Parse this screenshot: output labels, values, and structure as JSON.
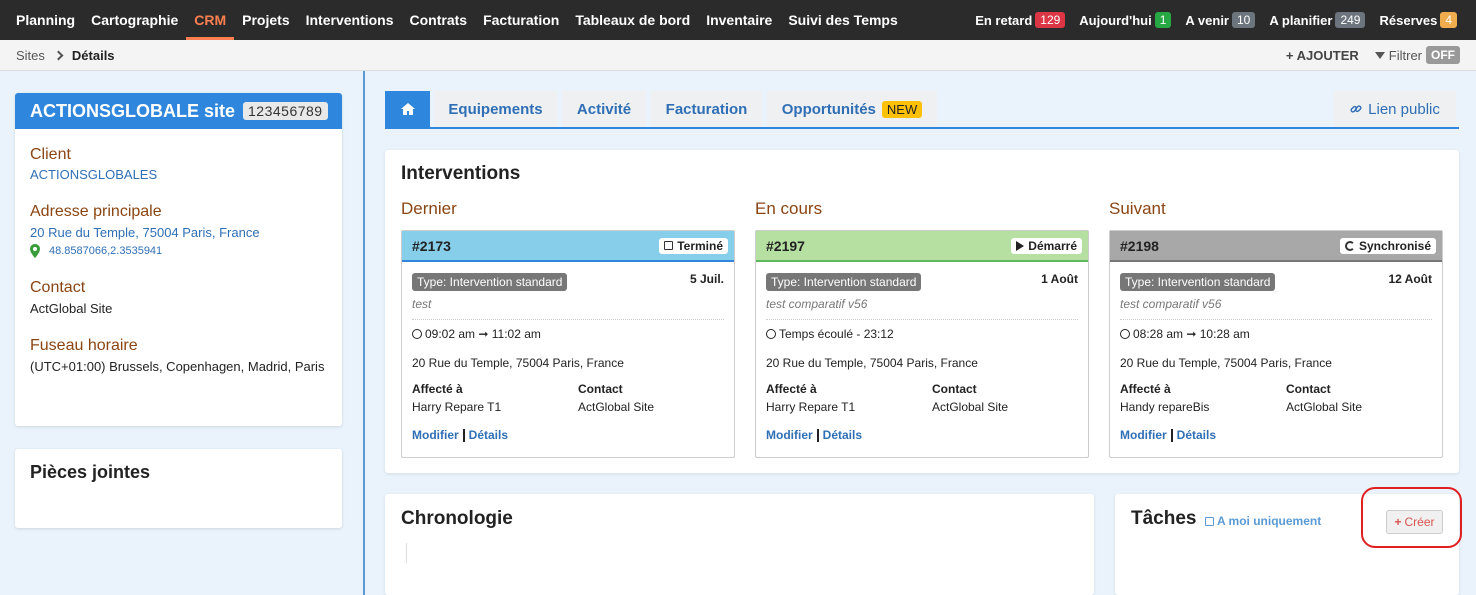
{
  "nav": {
    "items": [
      "Planning",
      "Cartographie",
      "CRM",
      "Projets",
      "Interventions",
      "Contrats",
      "Facturation",
      "Tableaux de bord",
      "Inventaire",
      "Suivi des Temps"
    ],
    "active": "CRM",
    "stats": [
      {
        "label": "En retard",
        "count": "129",
        "color": "#dc3545"
      },
      {
        "label": "Aujourd'hui",
        "count": "1",
        "color": "#28a745"
      },
      {
        "label": "A venir",
        "count": "10",
        "color": "#6c757d"
      },
      {
        "label": "A planifier",
        "count": "249",
        "color": "#6c757d"
      },
      {
        "label": "Réserves",
        "count": "4",
        "color": "#f0ad4e"
      }
    ]
  },
  "breadcrumb": {
    "parent": "Sites",
    "current": "Détails"
  },
  "toolbar": {
    "add": "AJOUTER",
    "filter": "Filtrer",
    "filter_state": "OFF"
  },
  "site": {
    "name": "ACTIONSGLOBALE site",
    "id": "123456789",
    "client_label": "Client",
    "client": "ACTIONSGLOBALES",
    "address_label": "Adresse principale",
    "address": "20 Rue du Temple, 75004 Paris, France",
    "coords": "48.8587066,2.3535941",
    "contact_label": "Contact",
    "contact": "ActGlobal Site",
    "tz_label": "Fuseau horaire",
    "tz": "(UTC+01:00) Brussels, Copenhagen, Madrid, Paris"
  },
  "attachments_title": "Pièces jointes",
  "tabs": {
    "equipements": "Equipements",
    "activite": "Activité",
    "facturation": "Facturation",
    "opportunites": "Opportunités",
    "new_badge": "NEW",
    "lien_public": "Lien public"
  },
  "interventions": {
    "title": "Interventions",
    "columns": [
      "Dernier",
      "En cours",
      "Suivant"
    ],
    "cards": [
      {
        "num": "#2173",
        "status": "Terminé",
        "type": "Type: Intervention standard",
        "date": "5 Juil.",
        "desc": "test",
        "time": "09:02 am ➞ 11:02 am",
        "address": "20 Rue du Temple, 75004 Paris, France",
        "assigned_label": "Affecté à",
        "assigned": "Harry Repare T1",
        "contact_label": "Contact",
        "contact": "ActGlobal Site",
        "modify": "Modifier",
        "details": "Détails"
      },
      {
        "num": "#2197",
        "status": "Démarré",
        "type": "Type: Intervention standard",
        "date": "1 Août",
        "desc": "test comparatif v56",
        "time": "Temps écoulé - 23:12",
        "address": "20 Rue du Temple, 75004 Paris, France",
        "assigned_label": "Affecté à",
        "assigned": "Harry Repare T1",
        "contact_label": "Contact",
        "contact": "ActGlobal Site",
        "modify": "Modifier",
        "details": "Détails"
      },
      {
        "num": "#2198",
        "status": "Synchronisé",
        "type": "Type: Intervention standard",
        "date": "12 Août",
        "desc": "test comparatif v56",
        "time": "08:28 am ➞ 10:28 am",
        "address": "20 Rue du Temple, 75004 Paris, France",
        "assigned_label": "Affecté à",
        "assigned": "Handy repareBis",
        "contact_label": "Contact",
        "contact": "ActGlobal Site",
        "modify": "Modifier",
        "details": "Détails"
      }
    ]
  },
  "chronologie": {
    "title": "Chronologie"
  },
  "taches": {
    "title": "Tâches",
    "only_me": "A moi uniquement",
    "create": "Créer"
  }
}
